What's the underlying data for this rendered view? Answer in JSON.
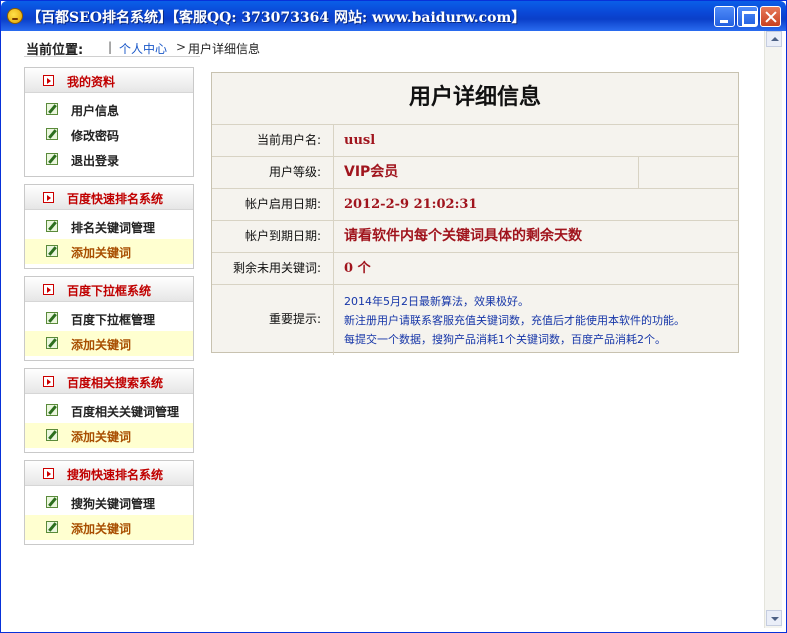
{
  "window": {
    "title": "【百都SEO排名系统】【客服QQ: 373073364 网站: www.baidurw.com】"
  },
  "breadcrumb": {
    "label": "当前位置:",
    "separator": "|",
    "link": "个人中心",
    "arrow": ">",
    "current": "用户详细信息"
  },
  "sidebar": {
    "sections": [
      {
        "title": "我的资料",
        "items": [
          {
            "label": "用户信息"
          },
          {
            "label": "修改密码"
          },
          {
            "label": "退出登录"
          }
        ]
      },
      {
        "title": "百度快速排名系统",
        "items": [
          {
            "label": "排名关键词管理"
          },
          {
            "label": "添加关键词"
          }
        ]
      },
      {
        "title": "百度下拉框系统",
        "items": [
          {
            "label": "百度下拉框管理"
          },
          {
            "label": "添加关键词"
          }
        ]
      },
      {
        "title": "百度相关搜索系统",
        "items": [
          {
            "label": "百度相关关键词管理"
          },
          {
            "label": "添加关键词"
          }
        ]
      },
      {
        "title": "搜狗快速排名系统",
        "items": [
          {
            "label": "搜狗关键词管理"
          },
          {
            "label": "添加关键词"
          }
        ]
      }
    ]
  },
  "panel": {
    "title": "用户详细信息",
    "rows": [
      {
        "label": "当前用户名:",
        "value": "uusl"
      },
      {
        "label": "用户等级:",
        "value": "VIP会员"
      },
      {
        "label": "帐户启用日期:",
        "value": "2012-2-9 21:02:31"
      },
      {
        "label": "帐户到期日期:",
        "value": "请看软件内每个关键词具体的剩余天数"
      },
      {
        "label": "剩余未用关键词:",
        "value": "0 个"
      },
      {
        "label": "重要提示:",
        "tips": [
          "2014年5月2日最新算法，效果极好。",
          "新注册用户请联系客服充值关键词数，充值后才能使用本软件的功能。",
          "每提交一个数据，搜狗产品消耗1个关键词数，百度产品消耗2个。"
        ]
      }
    ]
  },
  "colors": {
    "titlebar": "#0a47d6",
    "section_title": "#c00000",
    "value": "#a0141d",
    "tips": "#1636a8",
    "highlight": "#ffffd0"
  }
}
